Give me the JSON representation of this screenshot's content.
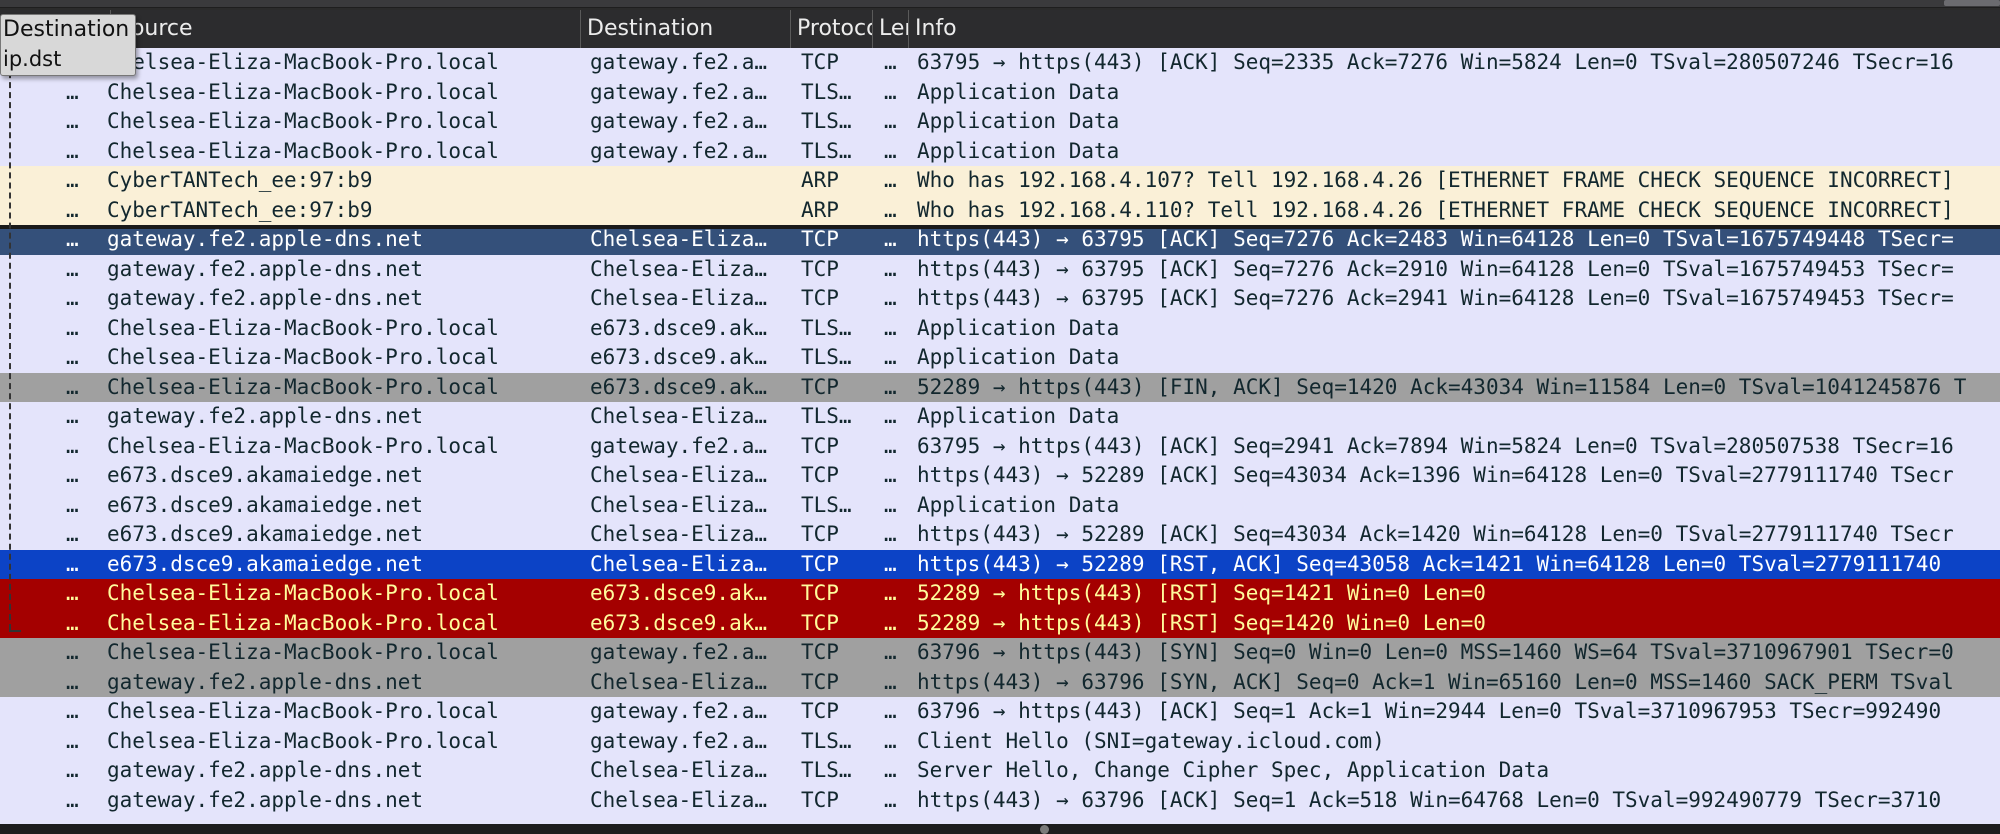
{
  "header": {
    "no": "",
    "source": "Source",
    "destination": "Destination",
    "protocol": "Protocol",
    "length": "Length",
    "info": "Info"
  },
  "tooltip": {
    "title": "Destination",
    "field": "ip.dst"
  },
  "colors": {
    "tcp": "#e4e4fb",
    "arp": "#faf0d7",
    "selected_dark": "#34507a",
    "bad_tcp": "#a0a0a0",
    "selected": "#0c43c6",
    "rst": "#a40000",
    "text_dark": "#12272e",
    "text_red": "#fffc9c",
    "text_white": "#ffffff"
  },
  "packets": [
    {
      "no": "…",
      "source": "Chelsea-Eliza-MacBook-Pro.local",
      "destination": "gateway.fe2.a…",
      "protocol": "TCP",
      "length": "…",
      "info": "63795 → https(443) [ACK] Seq=2335 Ack=7276 Win=5824 Len=0 TSval=280507246 TSecr=16",
      "style": "tcp"
    },
    {
      "no": "…",
      "source": "Chelsea-Eliza-MacBook-Pro.local",
      "destination": "gateway.fe2.a…",
      "protocol": "TLS…",
      "length": "…",
      "info": "Application Data",
      "style": "tcp"
    },
    {
      "no": "…",
      "source": "Chelsea-Eliza-MacBook-Pro.local",
      "destination": "gateway.fe2.a…",
      "protocol": "TLS…",
      "length": "…",
      "info": "Application Data",
      "style": "tcp"
    },
    {
      "no": "…",
      "source": "Chelsea-Eliza-MacBook-Pro.local",
      "destination": "gateway.fe2.a…",
      "protocol": "TLS…",
      "length": "…",
      "info": "Application Data",
      "style": "tcp"
    },
    {
      "no": "…",
      "source": "CyberTANTech_ee:97:b9",
      "destination": "",
      "protocol": "ARP",
      "length": "…",
      "info": "Who has 192.168.4.107? Tell 192.168.4.26 [ETHERNET FRAME CHECK SEQUENCE INCORRECT]",
      "style": "arp"
    },
    {
      "no": "…",
      "source": "CyberTANTech_ee:97:b9",
      "destination": "",
      "protocol": "ARP",
      "length": "…",
      "info": "Who has 192.168.4.110? Tell 192.168.4.26 [ETHERNET FRAME CHECK SEQUENCE INCORRECT]",
      "style": "arp"
    },
    {
      "no": "…",
      "source": "gateway.fe2.apple-dns.net",
      "destination": "Chelsea-Eliza…",
      "protocol": "TCP",
      "length": "…",
      "info": "https(443) → 63795 [ACK] Seq=7276 Ack=2483 Win=64128 Len=0 TSval=1675749448 TSecr=",
      "style": "selected_dark"
    },
    {
      "no": "…",
      "source": "gateway.fe2.apple-dns.net",
      "destination": "Chelsea-Eliza…",
      "protocol": "TCP",
      "length": "…",
      "info": "https(443) → 63795 [ACK] Seq=7276 Ack=2910 Win=64128 Len=0 TSval=1675749453 TSecr=",
      "style": "tcp"
    },
    {
      "no": "…",
      "source": "gateway.fe2.apple-dns.net",
      "destination": "Chelsea-Eliza…",
      "protocol": "TCP",
      "length": "…",
      "info": "https(443) → 63795 [ACK] Seq=7276 Ack=2941 Win=64128 Len=0 TSval=1675749453 TSecr=",
      "style": "tcp"
    },
    {
      "no": "…",
      "source": "Chelsea-Eliza-MacBook-Pro.local",
      "destination": "e673.dsce9.ak…",
      "protocol": "TLS…",
      "length": "…",
      "info": "Application Data",
      "style": "tcp"
    },
    {
      "no": "…",
      "source": "Chelsea-Eliza-MacBook-Pro.local",
      "destination": "e673.dsce9.ak…",
      "protocol": "TLS…",
      "length": "…",
      "info": "Application Data",
      "style": "tcp"
    },
    {
      "no": "…",
      "source": "Chelsea-Eliza-MacBook-Pro.local",
      "destination": "e673.dsce9.ak…",
      "protocol": "TCP",
      "length": "…",
      "info": "52289 → https(443) [FIN, ACK] Seq=1420 Ack=43034 Win=11584 Len=0 TSval=1041245876 T",
      "style": "bad_tcp"
    },
    {
      "no": "…",
      "source": "gateway.fe2.apple-dns.net",
      "destination": "Chelsea-Eliza…",
      "protocol": "TLS…",
      "length": "…",
      "info": "Application Data",
      "style": "tcp"
    },
    {
      "no": "…",
      "source": "Chelsea-Eliza-MacBook-Pro.local",
      "destination": "gateway.fe2.a…",
      "protocol": "TCP",
      "length": "…",
      "info": "63795 → https(443) [ACK] Seq=2941 Ack=7894 Win=5824 Len=0 TSval=280507538 TSecr=16",
      "style": "tcp"
    },
    {
      "no": "…",
      "source": "e673.dsce9.akamaiedge.net",
      "destination": "Chelsea-Eliza…",
      "protocol": "TCP",
      "length": "…",
      "info": "https(443) → 52289 [ACK] Seq=43034 Ack=1396 Win=64128 Len=0 TSval=2779111740 TSecr",
      "style": "tcp"
    },
    {
      "no": "…",
      "source": "e673.dsce9.akamaiedge.net",
      "destination": "Chelsea-Eliza…",
      "protocol": "TLS…",
      "length": "…",
      "info": "Application Data",
      "style": "tcp"
    },
    {
      "no": "…",
      "source": "e673.dsce9.akamaiedge.net",
      "destination": "Chelsea-Eliza…",
      "protocol": "TCP",
      "length": "…",
      "info": "https(443) → 52289 [ACK] Seq=43034 Ack=1420 Win=64128 Len=0 TSval=2779111740 TSecr",
      "style": "tcp"
    },
    {
      "no": "…",
      "source": "e673.dsce9.akamaiedge.net",
      "destination": "Chelsea-Eliza…",
      "protocol": "TCP",
      "length": "…",
      "info": "https(443) → 52289 [RST, ACK] Seq=43058 Ack=1421 Win=64128 Len=0 TSval=2779111740",
      "style": "selected"
    },
    {
      "no": "…",
      "source": "Chelsea-Eliza-MacBook-Pro.local",
      "destination": "e673.dsce9.ak…",
      "protocol": "TCP",
      "length": "…",
      "info": "52289 → https(443) [RST] Seq=1421 Win=0 Len=0",
      "style": "rst"
    },
    {
      "no": "…",
      "source": "Chelsea-Eliza-MacBook-Pro.local",
      "destination": "e673.dsce9.ak…",
      "protocol": "TCP",
      "length": "…",
      "info": "52289 → https(443) [RST] Seq=1420 Win=0 Len=0",
      "style": "rst"
    },
    {
      "no": "…",
      "source": "Chelsea-Eliza-MacBook-Pro.local",
      "destination": "gateway.fe2.a…",
      "protocol": "TCP",
      "length": "…",
      "info": "63796 → https(443) [SYN] Seq=0 Win=0 Len=0 MSS=1460 WS=64 TSval=3710967901 TSecr=0",
      "style": "bad_tcp"
    },
    {
      "no": "…",
      "source": "gateway.fe2.apple-dns.net",
      "destination": "Chelsea-Eliza…",
      "protocol": "TCP",
      "length": "…",
      "info": "https(443) → 63796 [SYN, ACK] Seq=0 Ack=1 Win=65160 Len=0 MSS=1460 SACK_PERM TSval",
      "style": "bad_tcp"
    },
    {
      "no": "…",
      "source": "Chelsea-Eliza-MacBook-Pro.local",
      "destination": "gateway.fe2.a…",
      "protocol": "TCP",
      "length": "…",
      "info": "63796 → https(443) [ACK] Seq=1 Ack=1 Win=2944 Len=0 TSval=3710967953 TSecr=992490",
      "style": "tcp"
    },
    {
      "no": "…",
      "source": "Chelsea-Eliza-MacBook-Pro.local",
      "destination": "gateway.fe2.a…",
      "protocol": "TLS…",
      "length": "…",
      "info": "Client Hello (SNI=gateway.icloud.com)",
      "style": "tcp"
    },
    {
      "no": "…",
      "source": "gateway.fe2.apple-dns.net",
      "destination": "Chelsea-Eliza…",
      "protocol": "TLS…",
      "length": "…",
      "info": "Server Hello, Change Cipher Spec, Application Data",
      "style": "tcp"
    },
    {
      "no": "…",
      "source": "gateway.fe2.apple-dns.net",
      "destination": "Chelsea-Eliza…",
      "protocol": "TCP",
      "length": "…",
      "info": "https(443) → 63796 [ACK] Seq=1 Ack=518 Win=64768 Len=0 TSval=992490779 TSecr=3710",
      "style": "tcp"
    }
  ]
}
